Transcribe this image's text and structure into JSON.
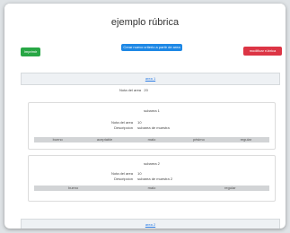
{
  "page": {
    "title": "ejemplo rúbrica"
  },
  "buttons": {
    "imprimir": "Imprimir",
    "crear": "Crear nuevo criterio a partir de area",
    "modificar": "modificar rúbrica"
  },
  "areas": [
    {
      "label": "area 1",
      "nota_label": "Nota del area",
      "nota_value": "20"
    },
    {
      "label": "area 2"
    }
  ],
  "subareas": [
    {
      "title": "subarea 1",
      "nota_label": "Nota del area",
      "nota_value": "10",
      "desc_label": "Descripcion",
      "desc_value": "subarea de muestra",
      "levels": [
        "bueno",
        "aceptable",
        "malo",
        "pésimo",
        "regular"
      ]
    },
    {
      "title": "subarea 2",
      "nota_label": "Nota del area",
      "nota_value": "10",
      "desc_label": "Descripcion",
      "desc_value": "subarea de muestra 2",
      "levels": [
        "bueno",
        "malo",
        "regular"
      ]
    }
  ]
}
